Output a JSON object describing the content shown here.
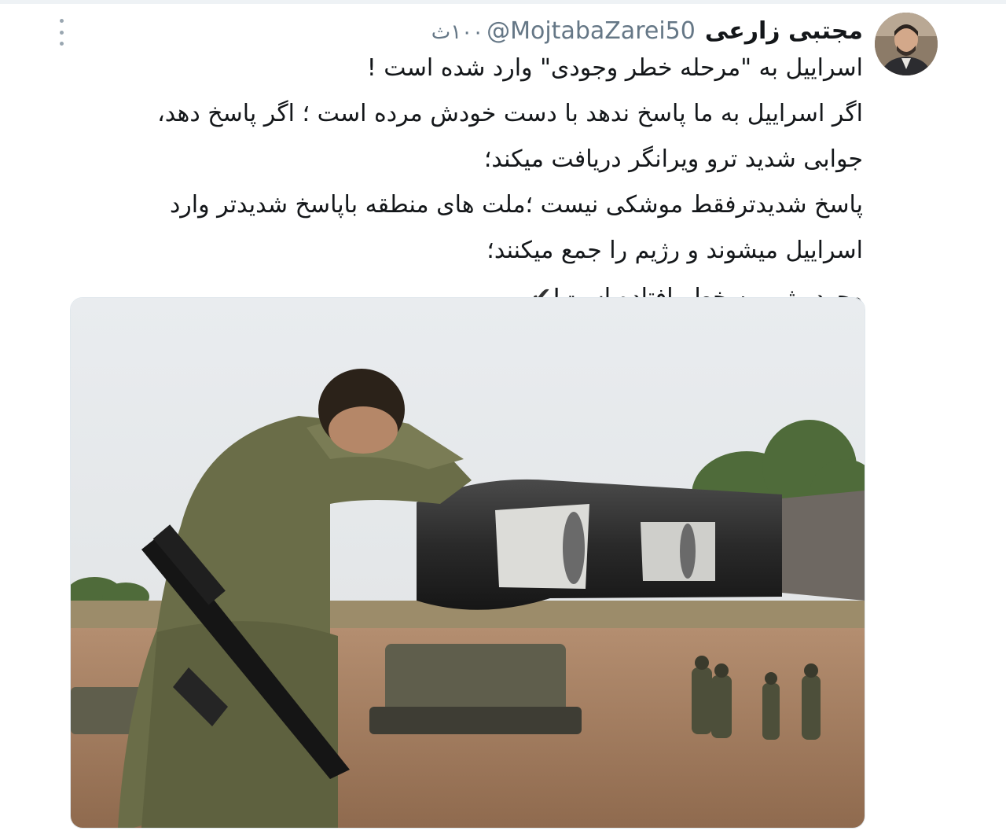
{
  "tweet": {
    "author_name": "مجتبی زارعی",
    "handle": "@MojtabaZarei50",
    "time": "۱۰۰ث",
    "lines": [
      "اسراییل به \"مرحله خطر وجودی\" وارد شده است !",
      "اگر اسراییل به ما پاسخ ندهد با دست خودش مرده است ؛ اگر پاسخ دهد،",
      "جوابی شدید ترو ویرانگر دریافت میکند؛",
      "پاسخ شدیدترفقط موشکی نیست ؛ملت های منطقه باپاسخ شدیدتر وارد",
      "اسراییل میشوند و رژیم را جمع میکنند؛",
      "وجود رژیم به خطر افتاده است!"
    ],
    "check_glyph": "✔",
    "media_description": "photo-of-soldier-leaning-on-artillery-barrel"
  },
  "icons": {
    "menu": "more-vertical-icon",
    "avatar": "user-avatar",
    "check": "checkmark-icon"
  },
  "colors": {
    "text": "#14171a",
    "secondary": "#657786",
    "border": "#e1e8ed"
  }
}
